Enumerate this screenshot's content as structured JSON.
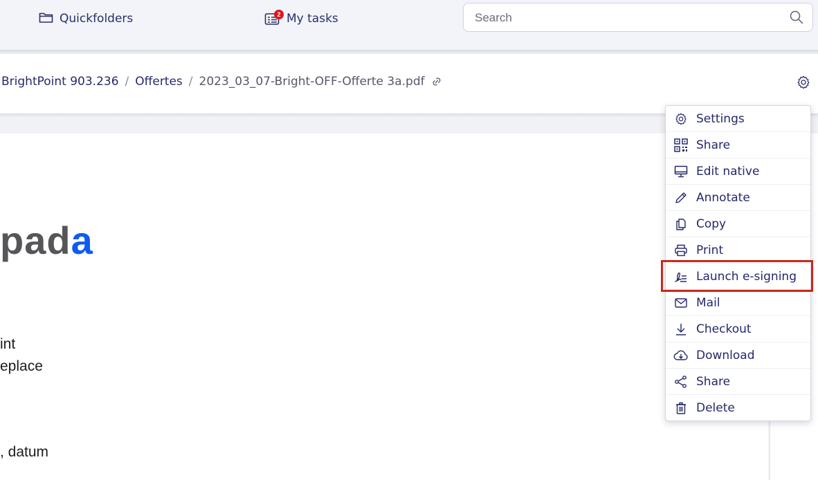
{
  "topbar": {
    "quickfolders_label": "Quickfolders",
    "mytasks_label": "My tasks",
    "mytasks_badge": "2",
    "search_placeholder": "Search",
    "search_value": ""
  },
  "breadcrumb": {
    "items": [
      "BrightPoint 903.236",
      "Offertes"
    ],
    "separator": "/",
    "current": "2023_03_07-Bright-OFF-Offerte 3a.pdf"
  },
  "document": {
    "logo_visible": "pada",
    "lines": [
      "int",
      "eplace",
      ", datum"
    ]
  },
  "menu": {
    "items": [
      {
        "label": "Settings",
        "icon": "gear-icon"
      },
      {
        "label": "Share",
        "icon": "qr-code-icon"
      },
      {
        "label": "Edit native",
        "icon": "monitor-icon"
      },
      {
        "label": "Annotate",
        "icon": "pencil-icon"
      },
      {
        "label": "Copy",
        "icon": "copy-icon"
      },
      {
        "label": "Print",
        "icon": "printer-icon"
      },
      {
        "label": "Launch e-signing",
        "icon": "signature-icon"
      },
      {
        "label": "Mail",
        "icon": "envelope-icon"
      },
      {
        "label": "Checkout",
        "icon": "arrow-down-icon"
      },
      {
        "label": "Download",
        "icon": "cloud-download-icon"
      },
      {
        "label": "Share",
        "icon": "share-nodes-icon"
      },
      {
        "label": "Delete",
        "icon": "trash-icon"
      }
    ],
    "highlighted_item": "Launch e-signing"
  },
  "colors": {
    "accent_text": "#24286a",
    "badge": "#e0141e",
    "highlight_box": "#c8281c",
    "logo_blue": "#0f5bf0",
    "logo_gray": "#56565a"
  }
}
